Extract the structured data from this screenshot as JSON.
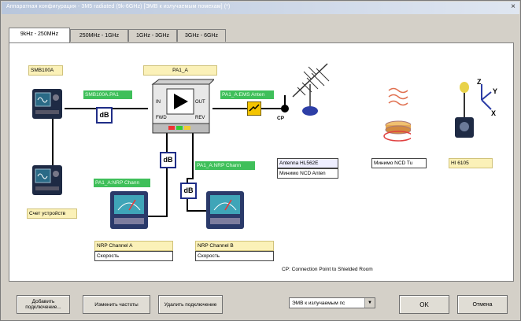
{
  "window": {
    "title": "Аппаратная конфигурация - 3M5 radiated (9k-6GHz) [ЭМВ к излучаемым помехам] (*)",
    "close": "×"
  },
  "tabs": [
    "9kHz - 250MHz",
    "250MHz - 1GHz",
    "1GHz - 3GHz",
    "3GHz - 6GHz"
  ],
  "diagram": {
    "gen1_label": "SMB100A",
    "amp_label": "PA1_A",
    "conn_gen_amp": "SMB100A.PA1",
    "conn_amp_ant": "PA1_A:EMS Anten",
    "gen2_label": "Счет устройств",
    "amp_in": "IN",
    "amp_out": "OUT",
    "amp_fwd": "FWD",
    "amp_rev": "REV",
    "conn_fwd": "PA1_A:NRP Chann",
    "conn_rev": "PA1_A:NRP Chann",
    "db": "dB",
    "cp": "CP",
    "antenna_name": "Antenna HL562E",
    "antenna_sub": "Минимо NCD Anten",
    "turntable_label": "Минимо NCD Tu",
    "field_probe_label": "HI 6105",
    "probe_axes": {
      "z": "Z",
      "y": "Y",
      "x": "X"
    },
    "pm1_name": "NRP Channel A",
    "pm1_sub": "Скорость",
    "pm2_name": "NRP Channel B",
    "pm2_sub": "Скорость",
    "cp_note": "CP: Connection Point to Shielded Room"
  },
  "buttons": {
    "add": "Добавить подключение...",
    "change": "Изменить частоты",
    "delete": "Удалить подключение",
    "select": "ЭМВ к излучаемым пс",
    "ok": "OK",
    "cancel": "Отмена"
  },
  "colors": {
    "instrument_body": "#1e2a44",
    "screen": "#2a6a86",
    "connector_green": "#3fbf5a",
    "db_box": "#1f2d87",
    "label_yellow": "#fbf1b8"
  }
}
